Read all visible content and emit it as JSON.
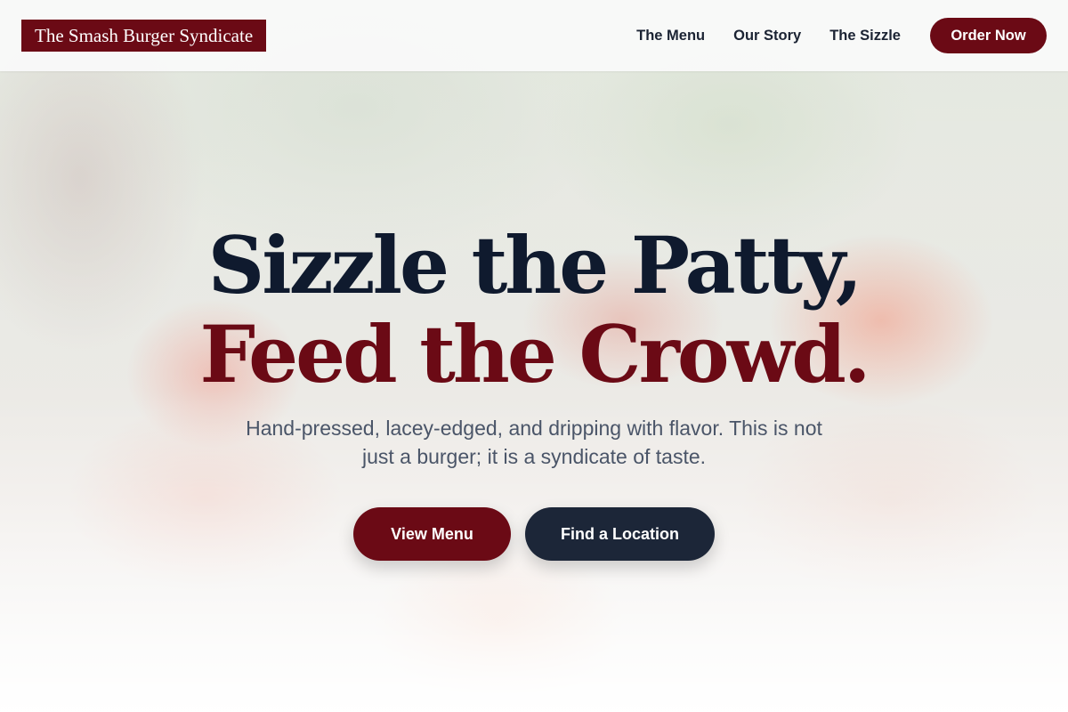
{
  "header": {
    "logo_text": "The Smash Burger Syndicate",
    "nav": [
      {
        "label": "The Menu"
      },
      {
        "label": "Our Story"
      },
      {
        "label": "The Sizzle"
      }
    ],
    "order_button": "Order Now"
  },
  "hero": {
    "title_line1": "Sizzle the Patty,",
    "title_line2": "Feed the Crowd.",
    "subtitle": "Hand-pressed, lacey-edged, and dripping with flavor. This is not just a burger; it is a syndicate of taste.",
    "primary_cta": "View Menu",
    "secondary_cta": "Find a Location",
    "background_image": "blurred-grill-photo"
  },
  "colors": {
    "brand": "#6b0a15",
    "navy": "#0f1a2e",
    "button_dark": "#1c2638",
    "text_muted": "#4a5568"
  }
}
